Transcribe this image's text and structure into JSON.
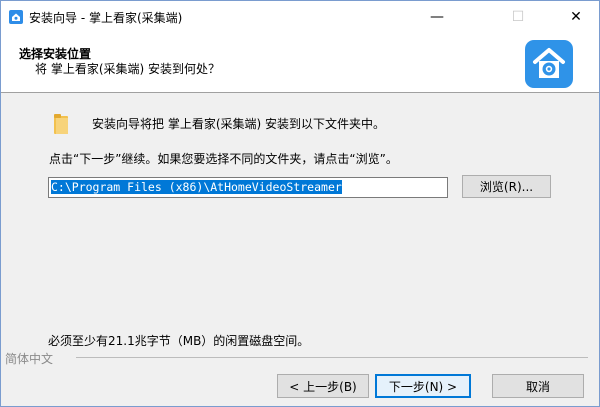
{
  "window": {
    "title": "安装向导 - 掌上看家(采集端)",
    "minimize_glyph": "—",
    "maximize_glyph": "☐",
    "close_glyph": "✕"
  },
  "header": {
    "title": "选择安装位置",
    "subtitle": "将 掌上看家(采集端) 安装到何处？",
    "logo_icon": "home-camera-logo-icon",
    "logo_color": "#2f93e8"
  },
  "body": {
    "intro": "安装向导将把 掌上看家(采集端) 安装到以下文件夹中。",
    "hint": "点击“下一步”继续。如果您要选择不同的文件夹，请点击“浏览”。",
    "install_path": "C:\\Program Files (x86)\\AtHomeVideoStreamer",
    "browse_label": "浏览(R)...",
    "space_required": "必须至少有21.1兆字节（MB）的闲置磁盘空间。"
  },
  "footer": {
    "language": "简体中文",
    "back_label": "< 上一步(B)",
    "next_label": "下一步(N) >",
    "cancel_label": "取消"
  },
  "colors": {
    "accent": "#0078d7",
    "folder": "#f2c14e"
  }
}
